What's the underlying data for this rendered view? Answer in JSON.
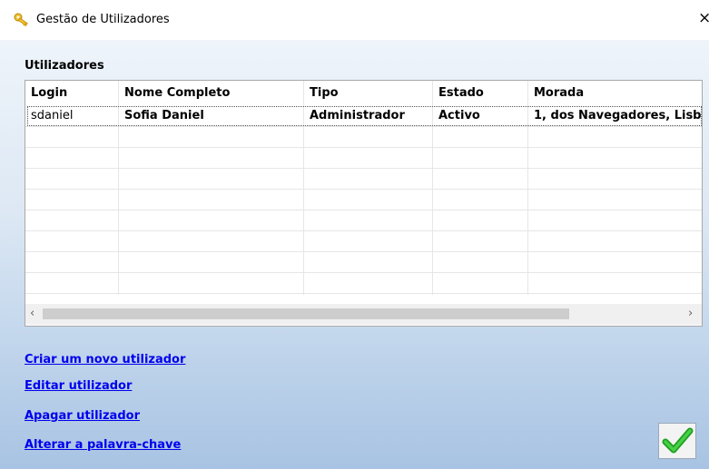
{
  "window": {
    "title": "Gestão de Utilizadores",
    "close_glyph": "×",
    "icon": "keys-icon"
  },
  "section": {
    "title": "Utilizadores"
  },
  "table": {
    "columns": [
      "Login",
      "Nome Completo",
      "Tipo",
      "Estado",
      "Morada"
    ],
    "rows": [
      {
        "login": "sdaniel",
        "nome": "Sofia Daniel",
        "tipo": "Administrador",
        "estado": "Activo",
        "morada": "1, dos Navegadores, Lisb"
      }
    ]
  },
  "scrollbar": {
    "left_arrow": "‹",
    "right_arrow": "›"
  },
  "actions": {
    "create": "Criar um novo utilizador",
    "edit": "Editar utilizador",
    "delete": "Apagar utilizador",
    "change_password": "Alterar a palavra-chave"
  },
  "ok_button": {
    "icon": "checkmark-icon",
    "color": "#2db52d"
  }
}
